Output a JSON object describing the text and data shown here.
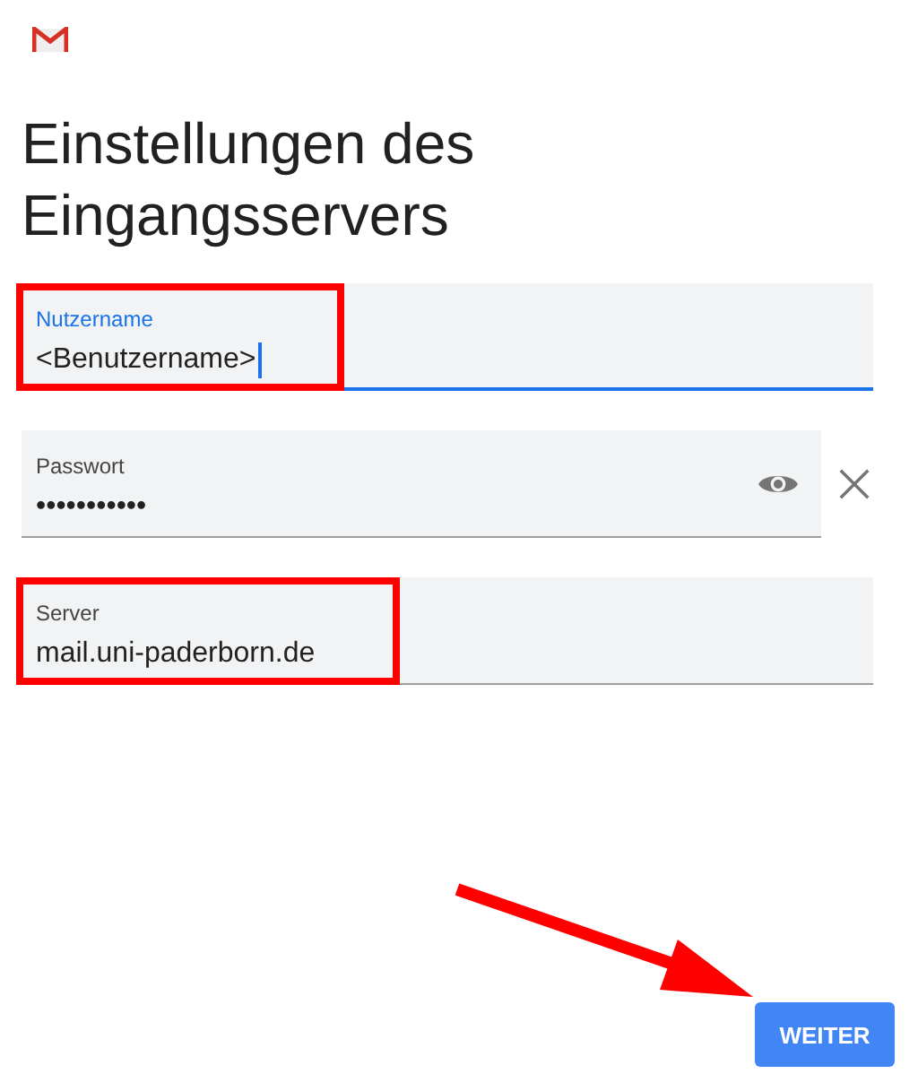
{
  "title": "Einstellungen des Eingangsservers",
  "fields": [
    {
      "kind": "text",
      "label": "Nutzername",
      "value": "<Benutzername>",
      "focused": true,
      "highlighted": true,
      "clearable": false
    },
    {
      "kind": "password",
      "label": "Passwort",
      "value": "•••••••••••",
      "focused": false,
      "highlighted": false,
      "clearable": true
    },
    {
      "kind": "text",
      "label": "Server",
      "value": "mail.uni-paderborn.de",
      "focused": false,
      "highlighted": true,
      "clearable": false
    }
  ],
  "next_button": {
    "label": "WEITER"
  },
  "annotation_arrow": {
    "shown": true
  }
}
